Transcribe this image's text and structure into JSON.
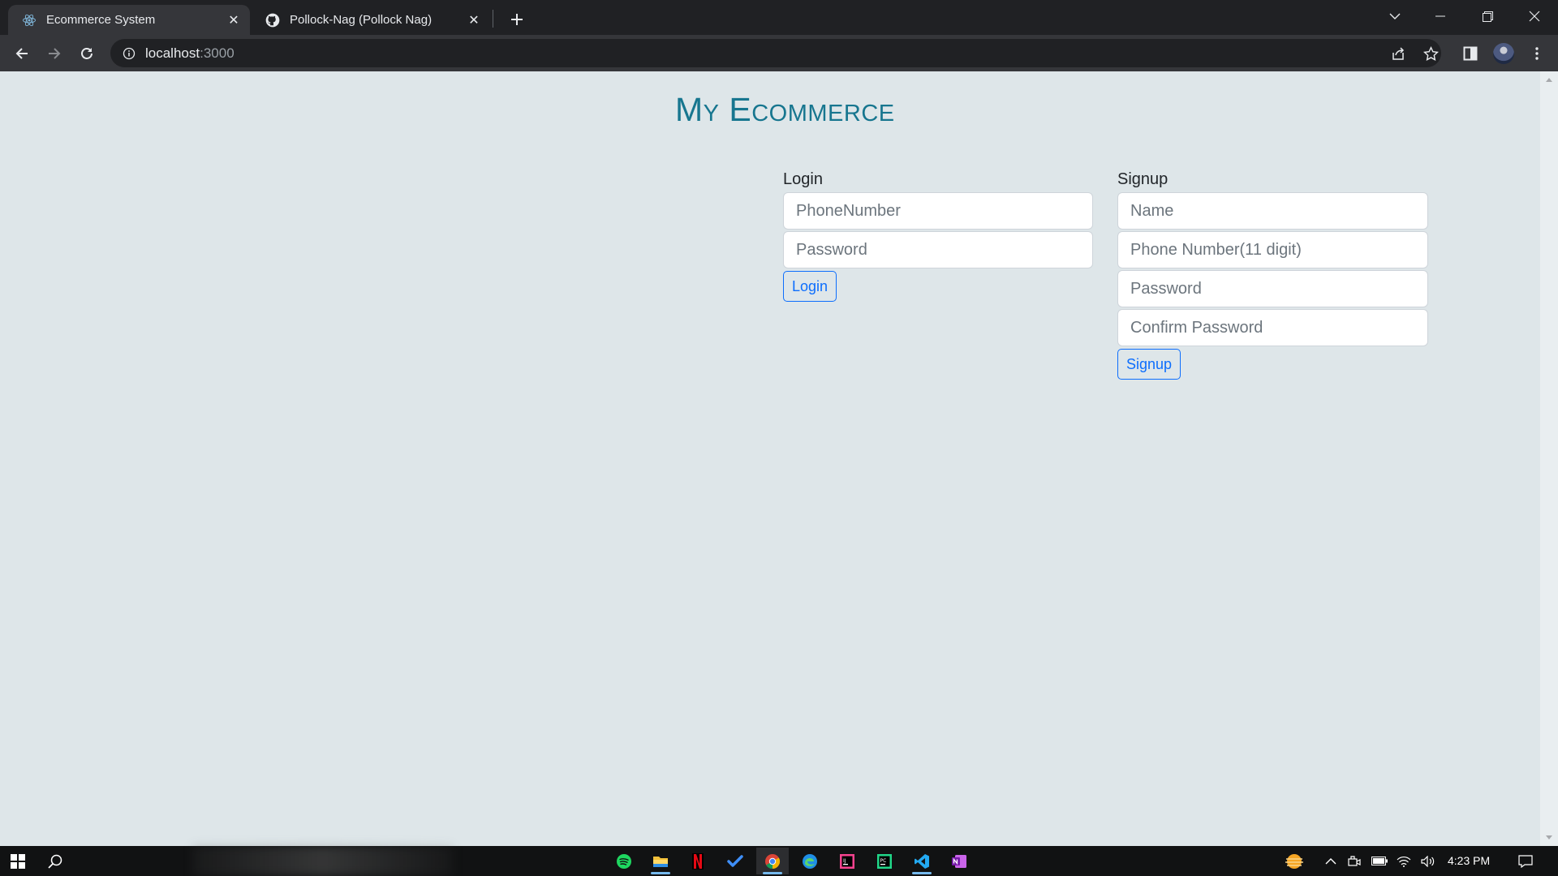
{
  "browser": {
    "tabs": [
      {
        "title": "Ecommerce System",
        "icon": "react-icon",
        "active": true
      },
      {
        "title": "Pollock-Nag (Pollock Nag)",
        "icon": "github-icon",
        "active": false
      }
    ],
    "url_host": "localhost",
    "url_port": ":3000"
  },
  "page": {
    "brand": "My Ecommerce",
    "login": {
      "heading": "Login",
      "phone_placeholder": "PhoneNumber",
      "password_placeholder": "Password",
      "button": "Login"
    },
    "signup": {
      "heading": "Signup",
      "name_placeholder": "Name",
      "phone_placeholder": "Phone Number(11 digit)",
      "password_placeholder": "Password",
      "confirm_placeholder": "Confirm Password",
      "button": "Signup"
    }
  },
  "taskbar": {
    "clock": "4:23 PM",
    "pinned": [
      "spotify-icon",
      "file-explorer-icon",
      "netflix-icon",
      "todo-icon",
      "chrome-icon",
      "edge-icon",
      "jetbrains-icon",
      "pycharm-icon",
      "vscode-icon",
      "onenote-icon"
    ]
  },
  "colors": {
    "page_bg": "#dee6e9",
    "brand": "#17768f",
    "primary": "#0d6efd"
  }
}
